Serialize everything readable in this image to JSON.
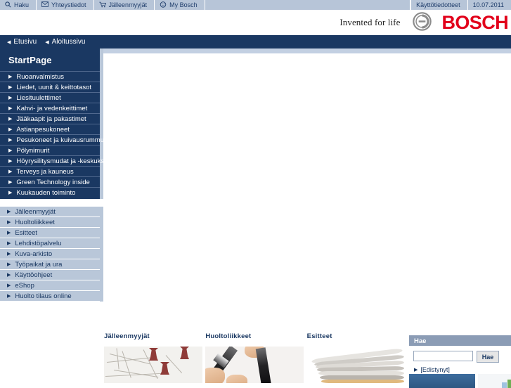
{
  "topbar": {
    "left_items": [
      {
        "label": "Haku",
        "icon": "search-icon"
      },
      {
        "label": "Yhteystiedot",
        "icon": "envelope-icon"
      },
      {
        "label": "Jälleenmyyjät",
        "icon": "cart-icon"
      },
      {
        "label": "My Bosch",
        "icon": "smiley-icon"
      }
    ],
    "right_items": [
      {
        "label": "Käyttötiedotteet"
      },
      {
        "label": "10.07.2011"
      }
    ]
  },
  "header": {
    "tagline": "Invented for life",
    "brand": "BOSCH",
    "logo_icon": "bosch-anchor-icon"
  },
  "breadcrumb": {
    "items": [
      {
        "label": "Etusivu"
      },
      {
        "label": "Aloitussivu"
      }
    ]
  },
  "sidebar": {
    "title": "StartPage",
    "primary_items": [
      {
        "label": "Ruoanvalmistus"
      },
      {
        "label": "Liedet, uunit & keittotasot"
      },
      {
        "label": "Liesituulettimet"
      },
      {
        "label": "Kahvi- ja vedenkeittimet"
      },
      {
        "label": "Jääkaapit ja pakastimet"
      },
      {
        "label": "Astianpesukoneet"
      },
      {
        "label": "Pesukoneet ja kuivausrummut"
      },
      {
        "label": "Pölynimurit"
      },
      {
        "label": "Höyrysilitysmudat ja -keskukset"
      },
      {
        "label": "Terveys ja kauneus"
      },
      {
        "label": "Green Technology inside"
      },
      {
        "label": "Kuukauden toiminto"
      }
    ],
    "secondary_items": [
      {
        "label": "Jälleenmyyjät"
      },
      {
        "label": "Huoltoliikkeet"
      },
      {
        "label": "Esitteet"
      },
      {
        "label": "Lehdistöpalvelu"
      },
      {
        "label": "Kuva-arkisto"
      },
      {
        "label": "Työpaikat ja ura"
      },
      {
        "label": "Käyttöohjeet"
      },
      {
        "label": "eShop"
      },
      {
        "label": "Huolto tilaus online"
      }
    ]
  },
  "main": {
    "teasers": [
      {
        "title": "Jälleenmyyjät",
        "image": "map-with-pins-image"
      },
      {
        "title": "Huoltoliikkeet",
        "image": "hands-with-tool-image"
      },
      {
        "title": "Esitteet",
        "image": "open-book-pages-image"
      }
    ]
  },
  "search": {
    "heading": "Hae",
    "input_value": "",
    "placeholder": "",
    "button_label": "Hae",
    "advanced_label": "[Edistynyt]"
  },
  "colors": {
    "navy": "#1a3862",
    "steel": "#b7c5d8",
    "brand_red": "#e2001a",
    "panel_head": "#8b9cb5"
  }
}
